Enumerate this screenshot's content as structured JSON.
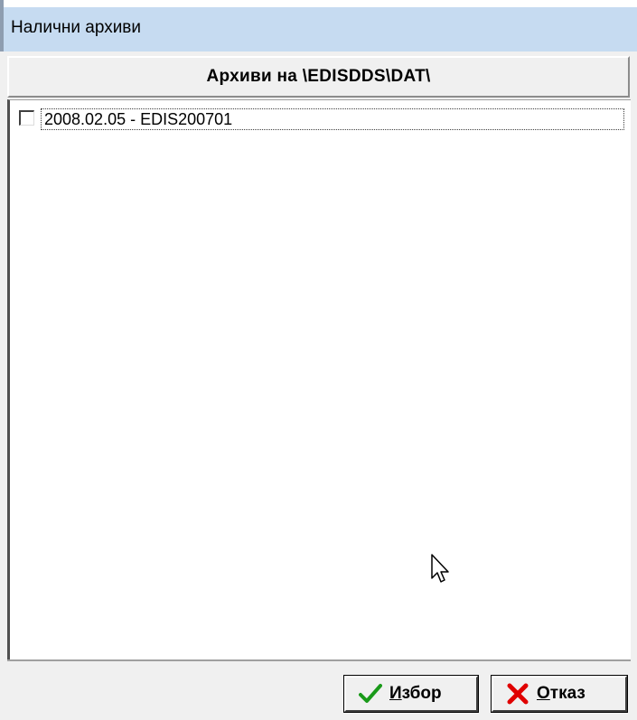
{
  "window": {
    "title": "Налични архиви"
  },
  "header": {
    "label": "Архиви на \\EDISDDS\\DAT\\"
  },
  "archives": [
    {
      "label": "2008.02.05 - EDIS200701",
      "checked": false
    }
  ],
  "buttons": {
    "ok": {
      "mnemonic": "И",
      "rest": "збор",
      "icon": "checkmark-icon",
      "icon_color": "#1a9a1a"
    },
    "cancel": {
      "mnemonic": "О",
      "rest": "тказ",
      "icon": "x-icon",
      "icon_color": "#e00000"
    }
  }
}
